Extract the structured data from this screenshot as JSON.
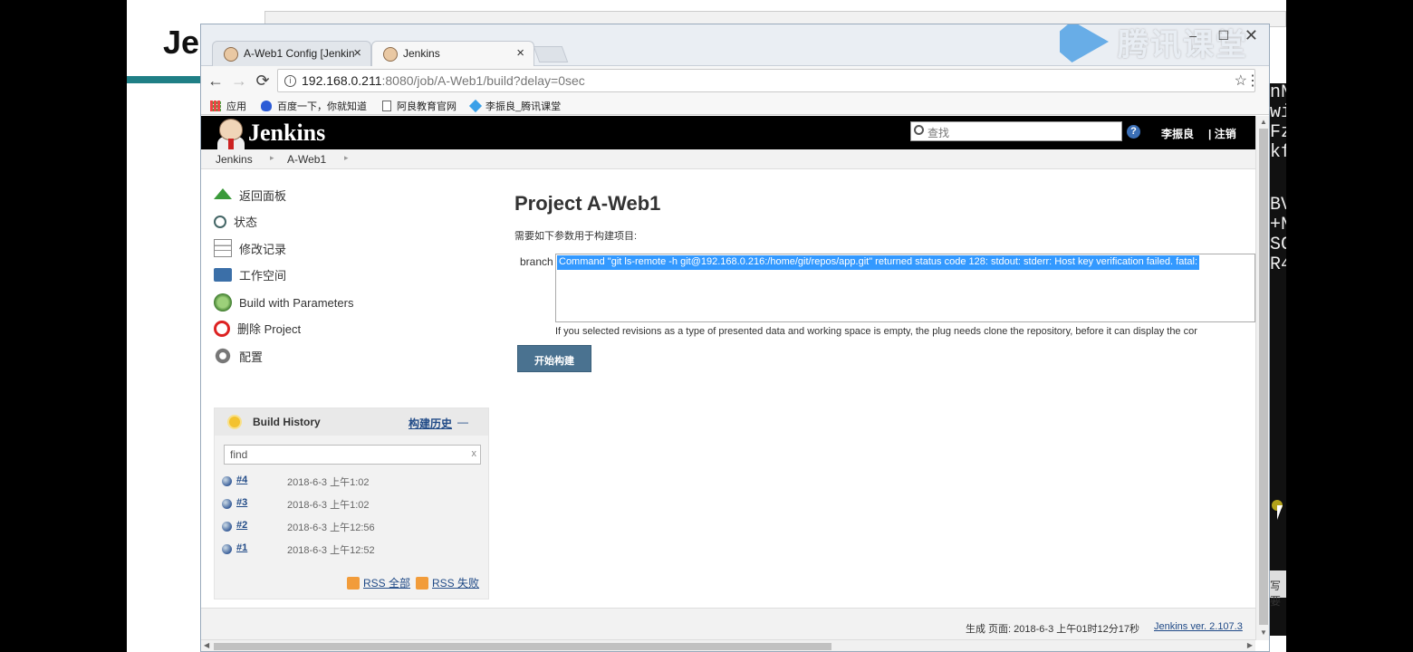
{
  "background": {
    "heading_fragment": "Je",
    "right_panel_lines": [
      "nN",
      "wi",
      "Fz",
      "kf",
      "",
      "BV",
      "+N",
      "SC",
      "R4"
    ],
    "right_lower_text": "写 要"
  },
  "watermark": {
    "text": "腾讯课堂",
    "logo": "tencent-classroom-logo"
  },
  "tabs": [
    {
      "label": "A-Web1 Config [Jenkin",
      "icon": "jenkins-icon"
    },
    {
      "label": "Jenkins",
      "icon": "jenkins-icon"
    }
  ],
  "window_controls": {
    "minimize": "–",
    "maximize": "☐",
    "close": "✕"
  },
  "address_bar": {
    "host": "192.168.0.211",
    "path": ":8080/job/A-Web1/build?delay=0sec"
  },
  "bookmarks": [
    {
      "label": "应用",
      "icon": "apps-icon"
    },
    {
      "label": "百度一下，你就知道",
      "icon": "baidu-icon"
    },
    {
      "label": "阿良教育官网",
      "icon": "page-icon"
    },
    {
      "label": "李振良_腾讯课堂",
      "icon": "tencent-icon"
    }
  ],
  "header": {
    "logo_text": "Jenkins",
    "search_placeholder": "查找",
    "help": "?",
    "user": "李振良",
    "logout": "| 注销"
  },
  "breadcrumb": [
    "Jenkins",
    "A-Web1"
  ],
  "tasks": [
    {
      "label": "返回面板",
      "icon": "up-arrow-icon"
    },
    {
      "label": "状态",
      "icon": "magnifier-icon"
    },
    {
      "label": "修改记录",
      "icon": "notepad-icon"
    },
    {
      "label": "工作空间",
      "icon": "folder-icon"
    },
    {
      "label": "Build with Parameters",
      "icon": "clock-icon"
    },
    {
      "label": "删除 Project",
      "icon": "no-entry-icon"
    },
    {
      "label": "配置",
      "icon": "gear-icon"
    }
  ],
  "build_history": {
    "title": "Build History",
    "trend_link": "构建历史",
    "trend_dash": "—",
    "find_placeholder": "find",
    "find_clear": "x",
    "builds": [
      {
        "number": "#4",
        "date": "2018-6-3 上午1:02"
      },
      {
        "number": "#3",
        "date": "2018-6-3 上午1:02"
      },
      {
        "number": "#2",
        "date": "2018-6-3 上午12:56"
      },
      {
        "number": "#1",
        "date": "2018-6-3 上午12:52"
      }
    ],
    "rss_all": "RSS 全部",
    "rss_failed": "RSS 失败"
  },
  "main": {
    "title": "Project A-Web1",
    "description": "需要如下参数用于构建项目:",
    "param_name": "branch",
    "param_selected_option": "Command \"git ls-remote -h git@192.168.0.216:/home/git/repos/app.git\" returned status code 128: stdout: stderr: Host key verification failed. fatal:",
    "param_help": "If you selected revisions as a type of presented data and working space is empty, the plug needs clone the repository, before it can display the cor",
    "build_button": "开始构建"
  },
  "footer": {
    "generated": "生成 页面: 2018-6-3 上午01时12分17秒",
    "version": "Jenkins ver. 2.107.3"
  }
}
